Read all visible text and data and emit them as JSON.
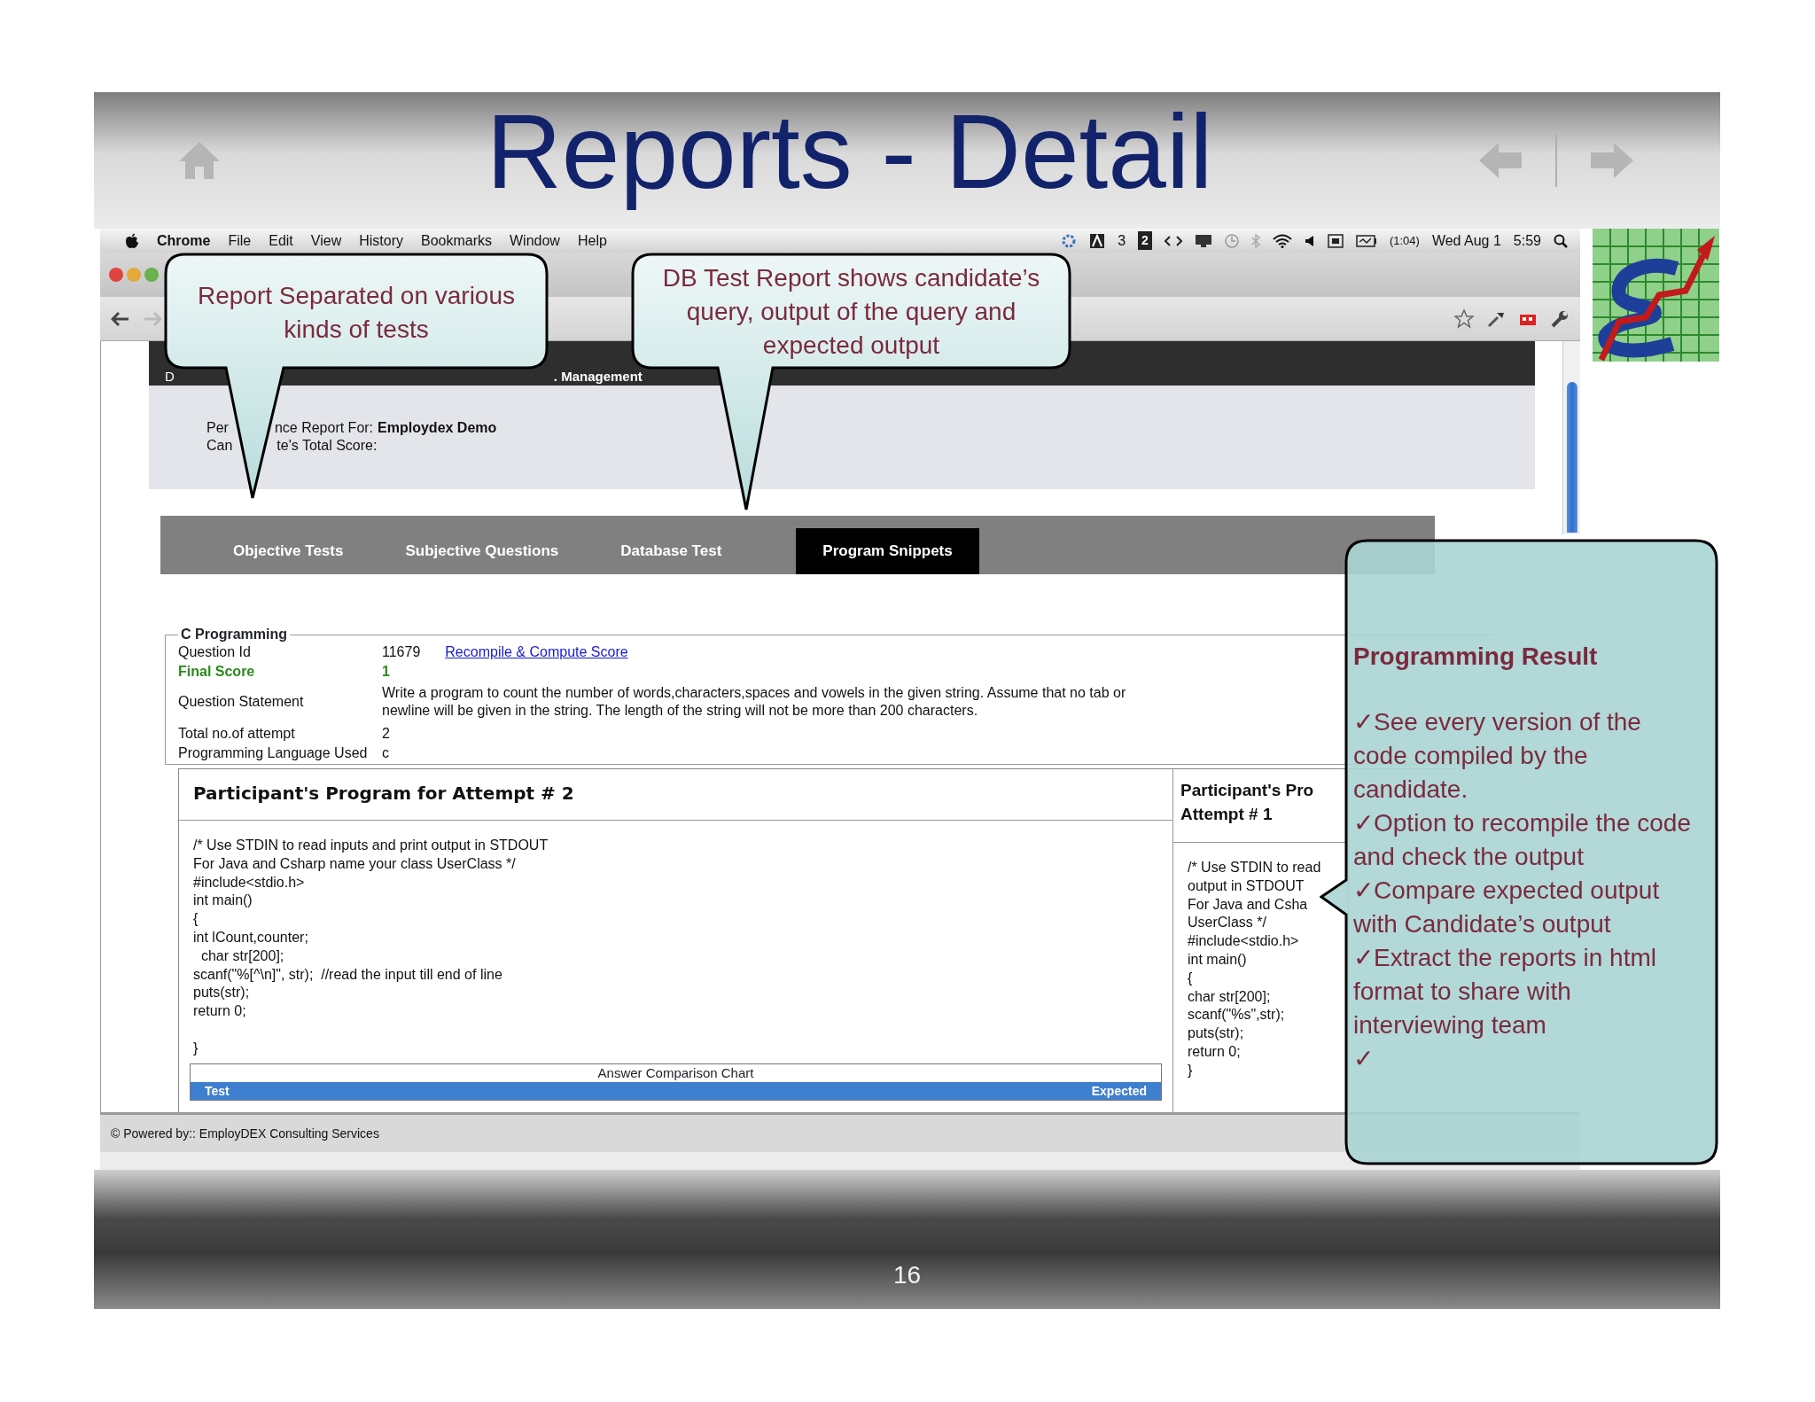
{
  "slide": {
    "title": "Reports - Detail",
    "page_number": "16"
  },
  "menu_bar": {
    "app": "Chrome",
    "menus": [
      "File",
      "Edit",
      "View",
      "History",
      "Bookmarks",
      "Window",
      "Help"
    ],
    "status": {
      "input_count": "3",
      "badge": "2",
      "battery_time": "(1:04)",
      "date": "Wed Aug 1",
      "time": "5:59"
    }
  },
  "page": {
    "header_start": "D",
    "header_end": ". Management",
    "report_for": {
      "start": "Per",
      "end": "nce Report For:",
      "name": "Employdex Demo"
    },
    "total_score": {
      "start": "Can",
      "end": "te's Total Score:"
    },
    "tabs": [
      {
        "label": "Objective Tests",
        "selected": false
      },
      {
        "label": "Subjective Questions",
        "selected": false
      },
      {
        "label": "Database Test",
        "selected": false
      },
      {
        "label": "Program Snippets",
        "selected": true
      }
    ],
    "section": {
      "legend": "C Programming",
      "fields": [
        {
          "label": "Question Id",
          "value": "11679",
          "kind": "plain",
          "link": "Recompile & Compute Score"
        },
        {
          "label": "Final Score",
          "value": "1",
          "kind": "score"
        },
        {
          "label": "Question Statement",
          "value": "Write a program to count the number of words,characters,spaces and vowels in the given string. Assume that no tab or newline will be given in the string. The length of the string will not be more than 200 characters.",
          "kind": "plain"
        },
        {
          "label": "Total no.of attempt",
          "value": "2",
          "kind": "plain"
        },
        {
          "label": "Programming Language Used",
          "value": "c",
          "kind": "plain"
        }
      ]
    },
    "attempts": [
      {
        "title_lines": [
          "Participant's Program for Attempt # 2"
        ],
        "code": "/* Use STDIN to read inputs and print output in STDOUT\nFor Java and Csharp name your class UserClass */\n#include<stdio.h>\nint main()\n{\nint lCount,counter;\n  char str[200];\nscanf(\"%[^\\n]\", str);  //read the input till end of line\nputs(str);\nreturn 0;\n\n}",
        "chart": {
          "title": "Answer Comparison Chart",
          "columns": [
            "Test",
            "Expected"
          ]
        }
      },
      {
        "title_lines": [
          "Participant's Pro",
          "Attempt # 1"
        ],
        "code": "/* Use STDIN to read\noutput in STDOUT\nFor Java and Csha\nUserClass */\n#include<stdio.h>\nint main()\n{\nchar str[200];\nscanf(\"%s\",str);\nputs(str);\nreturn 0;\n}"
      }
    ],
    "footer": "© Powered by:: EmployDEX Consulting Services"
  },
  "callouts": [
    {
      "text": "Report Separated on various kinds of tests"
    },
    {
      "text": "DB Test Report shows candidate’s query, output of the query and expected output"
    }
  ],
  "result_callout": {
    "title": "Programming Result",
    "points": [
      "✓See every version of the code compiled by the candidate.",
      "✓Option to recompile the code and check the output",
      "✓Compare expected output with Candidate’s output",
      "✓Extract the reports in html format to share with interviewing team",
      "✓"
    ]
  }
}
